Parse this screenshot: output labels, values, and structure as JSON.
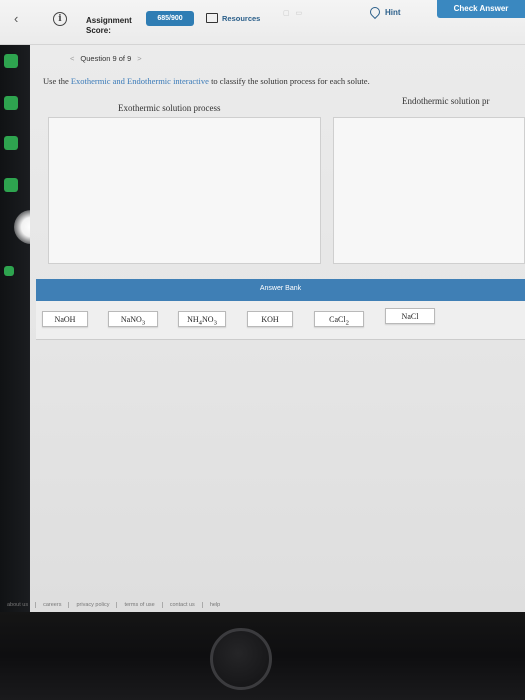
{
  "header": {
    "back_icon": "chevron-left-icon",
    "info_icon": "info-icon",
    "assignment_label": "Assignment",
    "score_label": "Score:",
    "score_value": "685/900",
    "resources_label": "Resources",
    "resources_icon": "folder-icon",
    "hint_label": "Hint",
    "hint_icon": "lightbulb-icon",
    "check_answer_label": "Check Answer"
  },
  "question_nav": {
    "prev": "<",
    "label": "Question 9 of 9",
    "next": ">"
  },
  "instruction": {
    "prefix": "Use the ",
    "link": "Exothermic and Endothermic interactive",
    "suffix": " to classify the solution process for each solute."
  },
  "columns": {
    "exothermic_title": "Exothermic solution process",
    "endothermic_title": "Endothermic solution pr"
  },
  "answer_bank": {
    "title": "Answer Bank",
    "chips": [
      {
        "base": "NaOH",
        "sub": "",
        "rest": "",
        "sub2": ""
      },
      {
        "base": "NaNO",
        "sub": "3",
        "rest": "",
        "sub2": ""
      },
      {
        "base": "NH",
        "sub": "4",
        "rest": "NO",
        "sub2": "3"
      },
      {
        "base": "KOH",
        "sub": "",
        "rest": "",
        "sub2": ""
      },
      {
        "base": "CaCl",
        "sub": "2",
        "rest": "",
        "sub2": ""
      },
      {
        "base": "NaCl",
        "sub": "",
        "rest": "",
        "sub2": ""
      }
    ]
  },
  "footer": {
    "links": [
      "about us",
      "careers",
      "privacy policy",
      "terms of use",
      "contact us",
      "help"
    ]
  },
  "colors": {
    "accent_blue": "#3a88c0",
    "bank_bar": "#3f7fb5",
    "link_blue": "#3a7ab8"
  }
}
